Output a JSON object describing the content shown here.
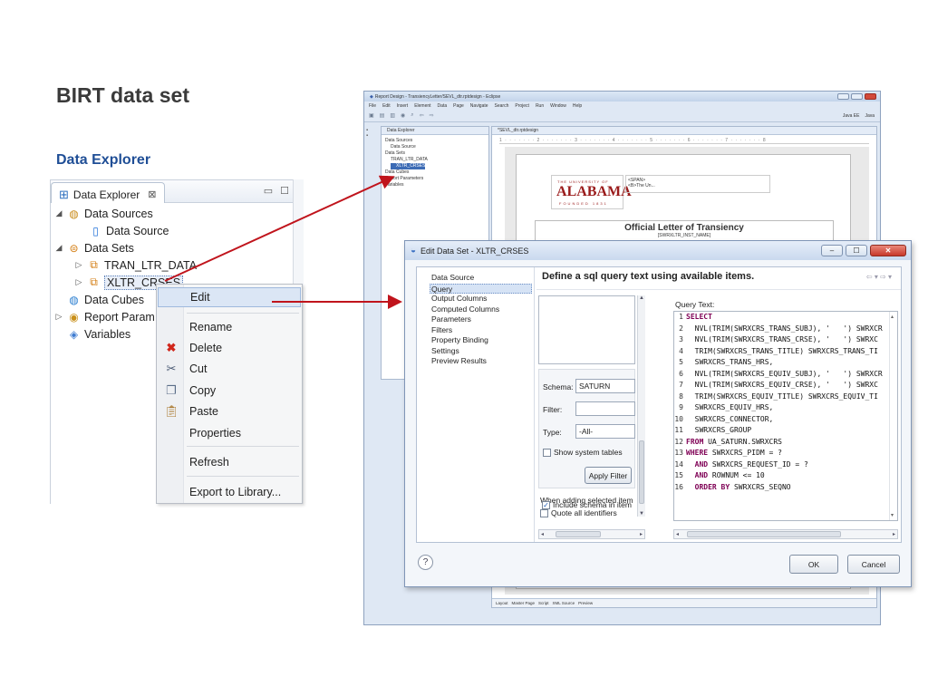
{
  "slide": {
    "title": "BIRT data set",
    "section": "Data Explorer"
  },
  "explorer": {
    "tab_label": "Data Explorer",
    "tab_close": "⊠",
    "tree": {
      "data_sources": "Data Sources",
      "data_source": "Data Source",
      "data_sets": "Data Sets",
      "tran_ltr_data": "TRAN_LTR_DATA",
      "xltr_crses": "XLTR_CRSES",
      "data_cubes": "Data Cubes",
      "report_params": "Report Param",
      "variables": "Variables"
    }
  },
  "context_menu": {
    "edit": "Edit",
    "rename": "Rename",
    "delete": "Delete",
    "cut": "Cut",
    "copy": "Copy",
    "paste": "Paste",
    "properties": "Properties",
    "refresh": "Refresh",
    "export": "Export to Library..."
  },
  "eclipse": {
    "title": "Report Design - TransiencyLetter/SEVL_dtr.rptdesign - Eclipse",
    "menu": [
      "File",
      "Edit",
      "Insert",
      "Element",
      "Data",
      "Page",
      "Navigate",
      "Search",
      "Project",
      "Run",
      "Window",
      "Help"
    ],
    "perspectives": [
      "Java EE",
      "Java"
    ],
    "left_view_title": "Data Explorer",
    "left_tree": [
      "Data Sources",
      "Data Source",
      "Data Sets",
      "TRAN_LTR_DATA",
      "XLTR_CRSES",
      "Data Cubes",
      "Report Parameters",
      "Variables"
    ],
    "editor_tab": "*SEVL_dtr.rptdesign",
    "logo_univ": "THE UNIVERSITY OF",
    "logo_main": "ALABAMA",
    "logo_sub": "FOUNDED 1831",
    "span_line1": "<SPAN>",
    "span_line2": "<B>The Un...",
    "letter_title": "Official Letter of Transiency",
    "letter_name": "[SWRXLTR_INST_NAME]",
    "bottom_tabs": [
      "Layout",
      "Master Page",
      "Script",
      "XML Source",
      "Preview"
    ]
  },
  "dialog": {
    "title": "Edit Data Set - XLTR_CRSES",
    "nav": [
      "Data Source",
      "Query",
      "Output Columns",
      "Computed Columns",
      "Parameters",
      "Filters",
      "Property Binding",
      "Settings",
      "Preview Results"
    ],
    "heading": "Define a sql query text using available items.",
    "schema_label": "Schema:",
    "schema_value": "SATURN",
    "filter_label": "Filter:",
    "filter_value": "",
    "type_label": "Type:",
    "type_value": "-All-",
    "show_system_tables": "Show system tables",
    "apply_filter": "Apply Filter",
    "adding_label": "When adding selected item",
    "quote_all": "Quote all identifiers",
    "include_schema": "Include schema in item",
    "query_text_label": "Query Text:",
    "query_lines": [
      {
        "n": "1",
        "kw": "SELECT",
        "rest": ""
      },
      {
        "n": "2",
        "kw": "",
        "rest": "  NVL(TRIM(SWRXCRS_TRANS_SUBJ), '   ') SWRXCR"
      },
      {
        "n": "3",
        "kw": "",
        "rest": "  NVL(TRIM(SWRXCRS_TRANS_CRSE), '   ') SWRXC"
      },
      {
        "n": "4",
        "kw": "",
        "rest": "  TRIM(SWRXCRS_TRANS_TITLE) SWRXCRS_TRANS_TI"
      },
      {
        "n": "5",
        "kw": "",
        "rest": "  SWRXCRS_TRANS_HRS,"
      },
      {
        "n": "6",
        "kw": "",
        "rest": "  NVL(TRIM(SWRXCRS_EQUIV_SUBJ), '   ') SWRXCR"
      },
      {
        "n": "7",
        "kw": "",
        "rest": "  NVL(TRIM(SWRXCRS_EQUIV_CRSE), '   ') SWRXC"
      },
      {
        "n": "8",
        "kw": "",
        "rest": "  TRIM(SWRXCRS_EQUIV_TITLE) SWRXCRS_EQUIV_TI"
      },
      {
        "n": "9",
        "kw": "",
        "rest": "  SWRXCRS_EQUIV_HRS,"
      },
      {
        "n": "10",
        "kw": "",
        "rest": "  SWRXCRS_CONNECTOR,"
      },
      {
        "n": "11",
        "kw": "",
        "rest": "  SWRXCRS_GROUP"
      },
      {
        "n": "12",
        "kw": "FROM",
        "rest": " UA_SATURN.SWRXCRS"
      },
      {
        "n": "13",
        "kw": "WHERE",
        "rest": " SWRXCRS_PIDM = ?"
      },
      {
        "n": "14",
        "kw": "  AND",
        "rest": " SWRXCRS_REQUEST_ID = ?"
      },
      {
        "n": "15",
        "kw": "  AND",
        "rest": " ROWNUM <= 10"
      },
      {
        "n": "16",
        "kw": "  ORDER BY",
        "rest": " SWRXCRS_SEQNO"
      }
    ],
    "help": "?",
    "ok": "OK",
    "cancel": "Cancel"
  }
}
